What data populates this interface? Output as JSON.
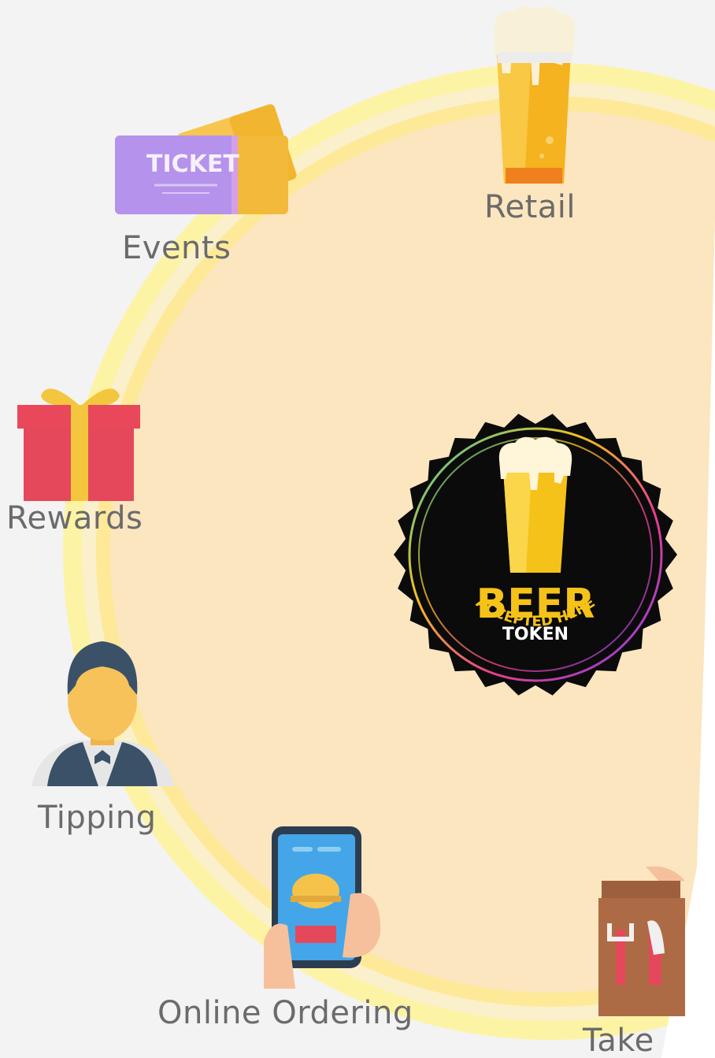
{
  "items": {
    "retail": {
      "label": "Retail"
    },
    "events": {
      "label": "Events",
      "ticket_text": "TICKET"
    },
    "rewards": {
      "label": "Rewards"
    },
    "tipping": {
      "label": "Tipping"
    },
    "online_ordering": {
      "label": "Online Ordering"
    },
    "takeaway": {
      "label": "Take"
    }
  },
  "badge": {
    "line1": "BEER",
    "line2": "TOKEN",
    "line3": "ACCEPTED HERE"
  },
  "colors": {
    "ring": "#fdf09a",
    "disk": "#fbe7bd",
    "label": "#6b6b6b",
    "badge_yellow": "#f5c21a"
  }
}
